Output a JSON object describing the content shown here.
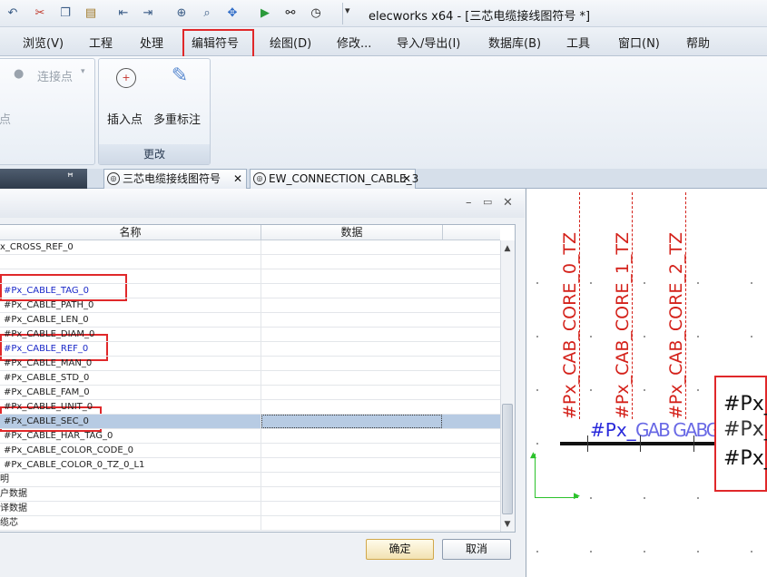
{
  "app": {
    "title": "elecworks x64 - [三芯电缆接线图符号 *]"
  },
  "quick_access": {
    "icons": [
      "undo-icon",
      "cut-icon",
      "copy-icon",
      "paste-icon",
      "import-icon",
      "export-icon",
      "zoom-fit-icon",
      "zoom-icon",
      "pan-icon",
      "refresh-icon",
      "binoculars-icon",
      "clock-icon",
      "dropdown-icon"
    ]
  },
  "menu": {
    "tabs": [
      "浏览(V)",
      "工程",
      "处理",
      "编辑符号",
      "绘图(D)",
      "修改...",
      "导入/导出(I)",
      "数据库(B)",
      "工具",
      "窗口(N)",
      "帮助"
    ],
    "active": "编辑符号"
  },
  "ribbon": {
    "connect_point": "连接点",
    "partial_label": "点",
    "insert_point": "插入点",
    "multi_annotation": "多重标注",
    "group_modify": "更改"
  },
  "panel": {
    "pin_icon": "pin-icon"
  },
  "doc_tabs": [
    {
      "label": "三芯电缆接线图符号",
      "icon": "symbol-icon"
    },
    {
      "label": "EW_CONNECTION_CABLE_3",
      "icon": "symbol-icon"
    }
  ],
  "dialog": {
    "columns": [
      "名称",
      "数据"
    ],
    "rows": [
      {
        "name": "x_CROSS_REF_0",
        "style": "left0"
      },
      {
        "name": "",
        "style": ""
      },
      {
        "name": "",
        "style": ""
      },
      {
        "name": "#Px_CABLE_TAG_0",
        "style": "blue"
      },
      {
        "name": "#Px_CABLE_PATH_0",
        "style": ""
      },
      {
        "name": "#Px_CABLE_LEN_0",
        "style": ""
      },
      {
        "name": "#Px_CABLE_DIAM_0",
        "style": ""
      },
      {
        "name": "#Px_CABLE_REF_0",
        "style": "blue"
      },
      {
        "name": "#Px_CABLE_MAN_0",
        "style": ""
      },
      {
        "name": "#Px_CABLE_STD_0",
        "style": ""
      },
      {
        "name": "#Px_CABLE_FAM_0",
        "style": ""
      },
      {
        "name": "#Px_CABLE_UNIT_0",
        "style": ""
      },
      {
        "name": "#Px_CABLE_SEC_0",
        "style": "selected"
      },
      {
        "name": "#Px_CABLE_HAR_TAG_0",
        "style": ""
      },
      {
        "name": "#Px_CABLE_COLOR_CODE_0",
        "style": ""
      },
      {
        "name": "#Px_CABLE_COLOR_0_TZ_0_L1",
        "style": ""
      },
      {
        "name": "明",
        "style": "left0"
      },
      {
        "name": "户数据",
        "style": "left0"
      },
      {
        "name": "译数据",
        "style": "left0"
      },
      {
        "name": "缆芯",
        "style": "left0"
      }
    ],
    "ok": "确定",
    "cancel": "取消"
  },
  "canvas": {
    "vertical_labels": [
      "#Px_CAB_CORE_0_TZ",
      "#Px_CAB_CORE_1_TZ",
      "#Px_CAB_CORE_2_TZ"
    ],
    "blue_label": "#Px_",
    "overlap_label": "GAB GABGAB",
    "box_label_1": "#Px_",
    "box_label_2": "#Px_",
    "box_label_3": "#Px_"
  }
}
